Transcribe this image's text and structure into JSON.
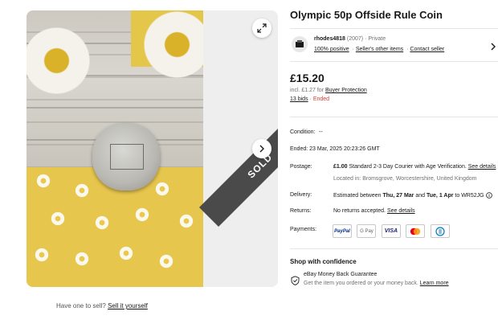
{
  "listing": {
    "title": "Olympic 50p Offside Rule Coin",
    "sold_badge": "SOLD"
  },
  "seller": {
    "username": "rhodes4818",
    "feedback_count": "(2007)",
    "visibility": "· Private",
    "positive": "100% positive",
    "other_items": "Seller's other items",
    "contact": "Contact seller"
  },
  "price": {
    "amount": "£15.20",
    "incl_prefix": "incl. £1.27 for",
    "buyer_protection": "Buyer Protection",
    "bids": "13 bids",
    "separator": "·",
    "status": "Ended"
  },
  "details": {
    "condition_label": "Condition:",
    "condition_value": "--",
    "ended_label": "Ended:",
    "ended_value": "23 Mar, 2025 20:23:26 GMT",
    "postage_label": "Postage:",
    "postage_cost": "£1.00",
    "postage_desc": "Standard 2-3 Day Courier with Age Verification.",
    "postage_link": "See details",
    "location": "Located in: Bromsgrove, Worcestershire, United Kingdom",
    "delivery_label": "Delivery:",
    "delivery_prefix": "Estimated between",
    "delivery_start": "Thu, 27 Mar",
    "delivery_and": "and",
    "delivery_end": "Tue, 1 Apr",
    "delivery_to": "to WR52JG",
    "returns_label": "Returns:",
    "returns_value": "No returns accepted.",
    "returns_link": "See details",
    "payments_label": "Payments:"
  },
  "payments": [
    "PayPal",
    "G Pay",
    "VISA",
    "MC",
    "D"
  ],
  "shop": {
    "heading": "Shop with confidence",
    "guarantee_title": "eBay Money Back Guarantee",
    "guarantee_desc": "Get the item you ordered or your money back.",
    "learn_more": "Learn more"
  },
  "sell": {
    "prompt": "Have one to sell?",
    "link": "Sell it yourself"
  },
  "colors": {
    "ended": "#d63a2f",
    "text": "#191919",
    "muted": "#707070",
    "paypal_blue": "#003087",
    "visa_blue": "#1a1f71",
    "mastercard_red": "#eb001b",
    "mastercard_orange": "#f79e1b"
  },
  "icons": {
    "expand": "expand-icon",
    "next": "chevron-right-icon",
    "seller_chevron": "chevron-right-icon",
    "info": "info-icon",
    "shield": "shield-check-icon"
  }
}
